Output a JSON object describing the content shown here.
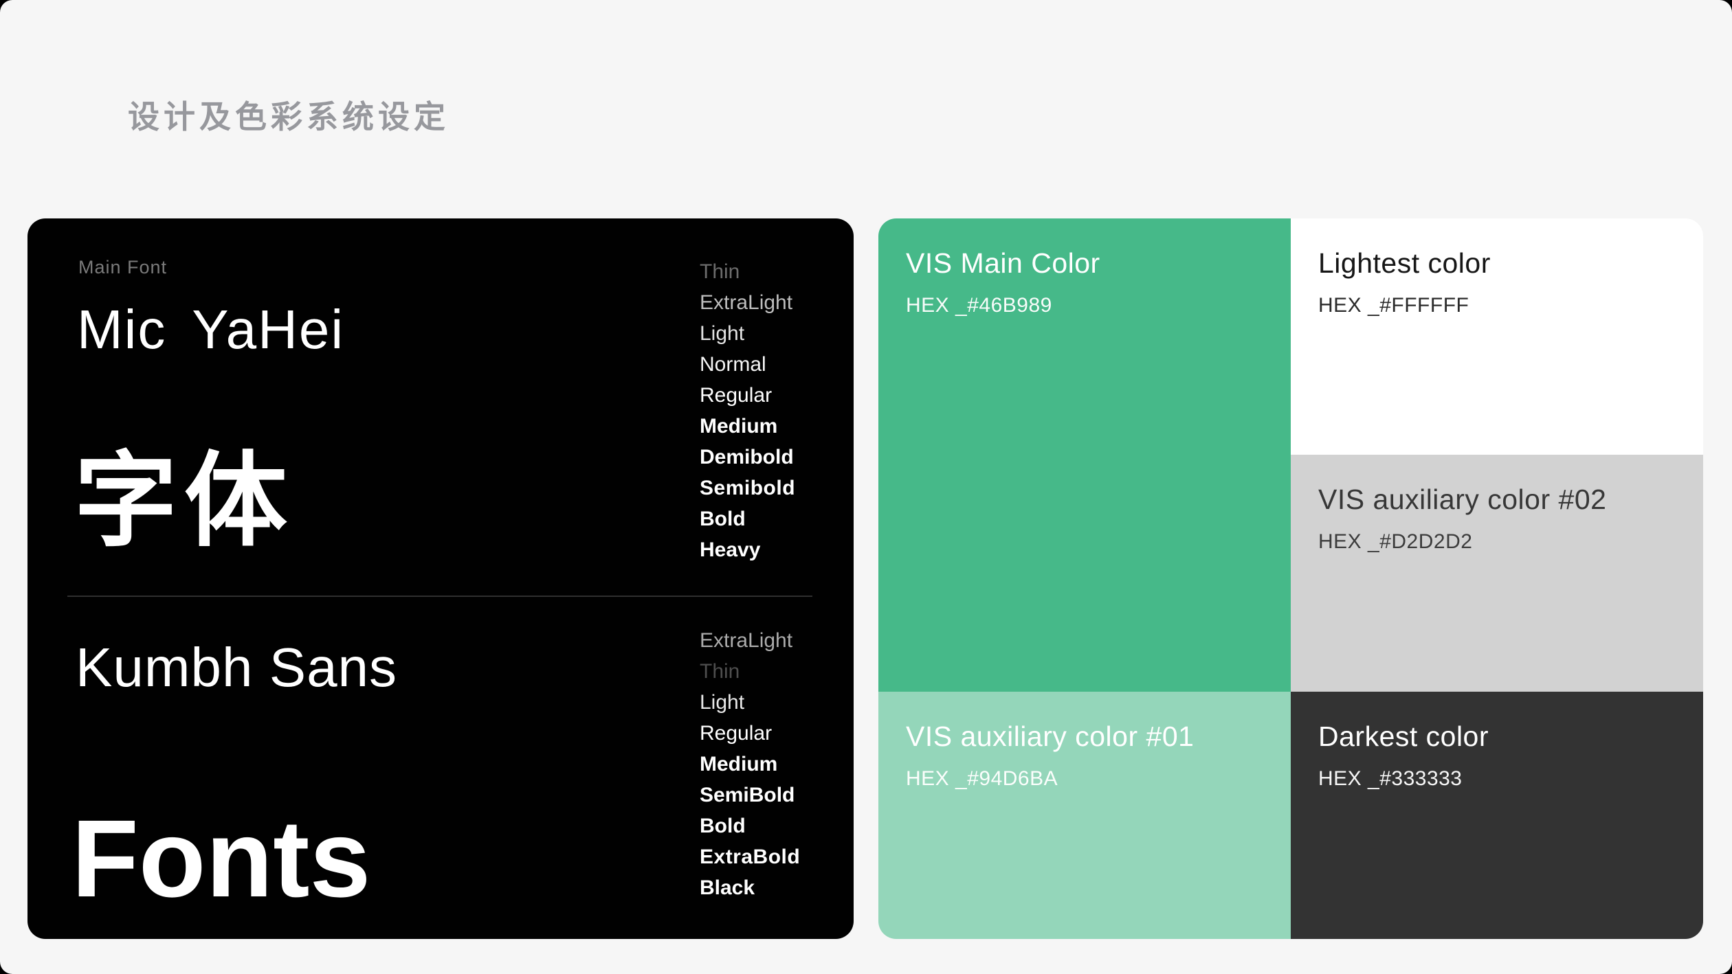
{
  "page": {
    "title": "设计及色彩系统设定"
  },
  "font_card": {
    "main_font_label": "Main Font",
    "font_1_name": "Mic YaHei",
    "font_1_specimen": "字体",
    "font_2_name": "Kumbh Sans",
    "font_2_specimen": "Fonts",
    "weights_1": [
      "Thin",
      "ExtraLight",
      "Light",
      "Normal",
      "Regular",
      "Medium",
      "Demibold",
      "Semibold",
      "Bold",
      "Heavy"
    ],
    "weights_2": [
      "ExtraLight",
      "Thin",
      "Light",
      "Regular",
      "Medium",
      "SemiBold",
      "Bold",
      "ExtraBold",
      "Black"
    ],
    "card_background": "#010101"
  },
  "colors": {
    "main": {
      "title": "VIS Main Color",
      "hex_label": "HEX _#46B989",
      "value": "#46B989"
    },
    "lightest": {
      "title": "Lightest color",
      "hex_label": "HEX _#FFFFFF",
      "value": "#FFFFFF"
    },
    "aux2": {
      "title": "VIS auxiliary color #02",
      "hex_label": "HEX _#D2D2D2",
      "value": "#D2D2D2"
    },
    "aux1": {
      "title": "VIS auxiliary color #01",
      "hex_label": "HEX _#94D6BA",
      "value": "#94D6BA"
    },
    "darkest": {
      "title": "Darkest color",
      "hex_label": "HEX _#333333",
      "value": "#333333"
    }
  }
}
